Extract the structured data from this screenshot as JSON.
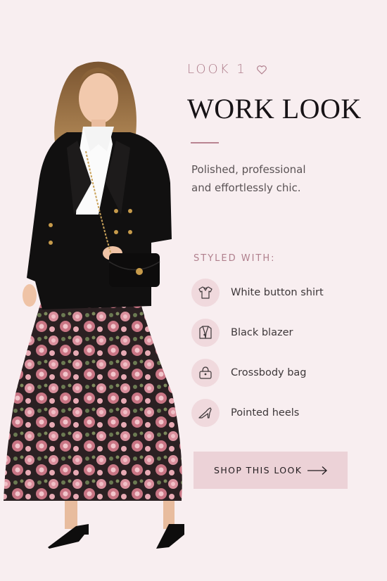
{
  "look": {
    "label": "LOOK 1",
    "icon": "heart-icon"
  },
  "title": "WORK LOOK",
  "tagline": {
    "line1": "Polished, professional",
    "line2": "and effortlessly chic."
  },
  "styled_with": {
    "label": "STYLED WITH:",
    "items": [
      {
        "label": "White button shirt",
        "icon": "shirt-icon"
      },
      {
        "label": "Black blazer",
        "icon": "blazer-icon"
      },
      {
        "label": "Crossbody bag",
        "icon": "bag-icon"
      },
      {
        "label": "Pointed heels",
        "icon": "heel-icon"
      }
    ]
  },
  "cta": {
    "label": "SHOP THIS LOOK",
    "icon": "arrow-right-icon"
  },
  "colors": {
    "background": "#f8eef0",
    "accent": "#b07f8d",
    "button": "#ecd2d7",
    "title": "#171316"
  }
}
